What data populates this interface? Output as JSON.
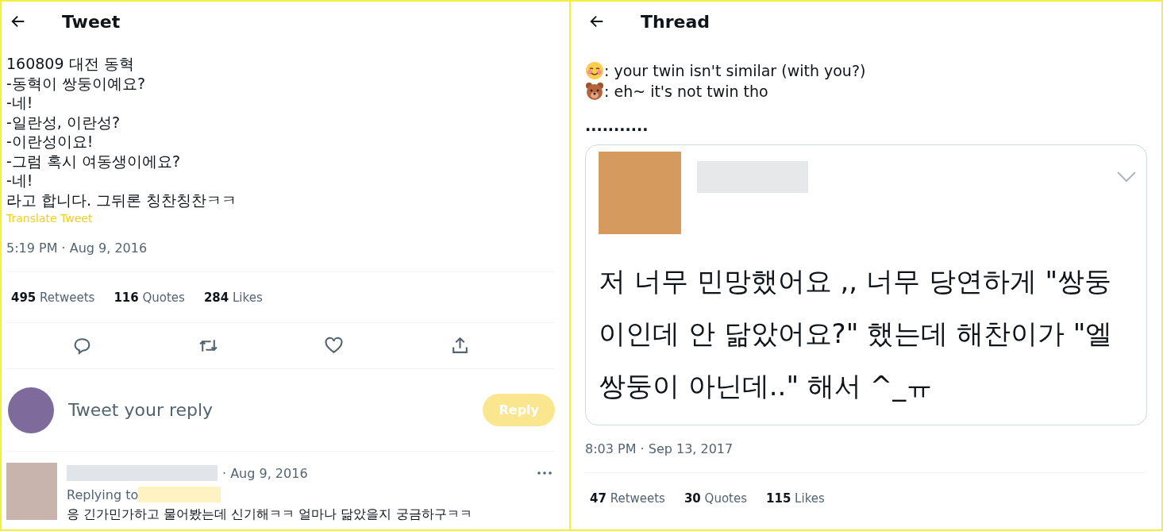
{
  "left": {
    "header": {
      "title": "Tweet"
    },
    "tweet": {
      "lines": [
        "160809 대전 동혁",
        "-동혁이 쌍둥이예요?",
        "-네!",
        "-일란성, 이란성?",
        "-이란성이요!",
        "-그럼 혹시 여동생이에요?",
        "-네!",
        "라고 합니다. 그뒤론 칭찬칭찬ㅋㅋ"
      ],
      "translate": "Translate Tweet",
      "timestamp": "5:19 PM · Aug 9, 2016",
      "stats": [
        {
          "count": "495",
          "label": "Retweets"
        },
        {
          "count": "116",
          "label": "Quotes"
        },
        {
          "count": "284",
          "label": "Likes"
        }
      ],
      "actions": [
        {
          "kind": "reply"
        },
        {
          "kind": "retweet"
        },
        {
          "kind": "like"
        },
        {
          "kind": "share"
        }
      ]
    },
    "composer": {
      "placeholder": "Tweet your reply",
      "button": "Reply",
      "disabled": true
    },
    "reply": {
      "date": "· Aug 9, 2016",
      "replying_to": "Replying to",
      "text": "응 긴가민가하고 물어봤는데 신기해ㅋㅋ 얼마나 닮았을지 궁금하구ㅋㅋ"
    }
  },
  "right": {
    "header": {
      "title": "Thread"
    },
    "lines": [
      {
        "kind": "smile",
        "text": ": your twin isn't similar (with you?)"
      },
      {
        "kind": "bear",
        "text": ": eh~ it's not twin tho"
      }
    ],
    "dots": "...........",
    "quote": {
      "text": "저 너무 민망했어요 ,, 너무 당연하게 \"쌍둥이인데 안 닮았어요?\" 했는데 해찬이가 \"엘 쌍둥이 아닌데..\" 해서 ^_ㅠ"
    },
    "timestamp": "8:03 PM · Sep 13, 2017",
    "stats": [
      {
        "count": "47",
        "label": "Retweets"
      },
      {
        "count": "30",
        "label": "Quotes"
      },
      {
        "count": "115",
        "label": "Likes"
      }
    ]
  }
}
